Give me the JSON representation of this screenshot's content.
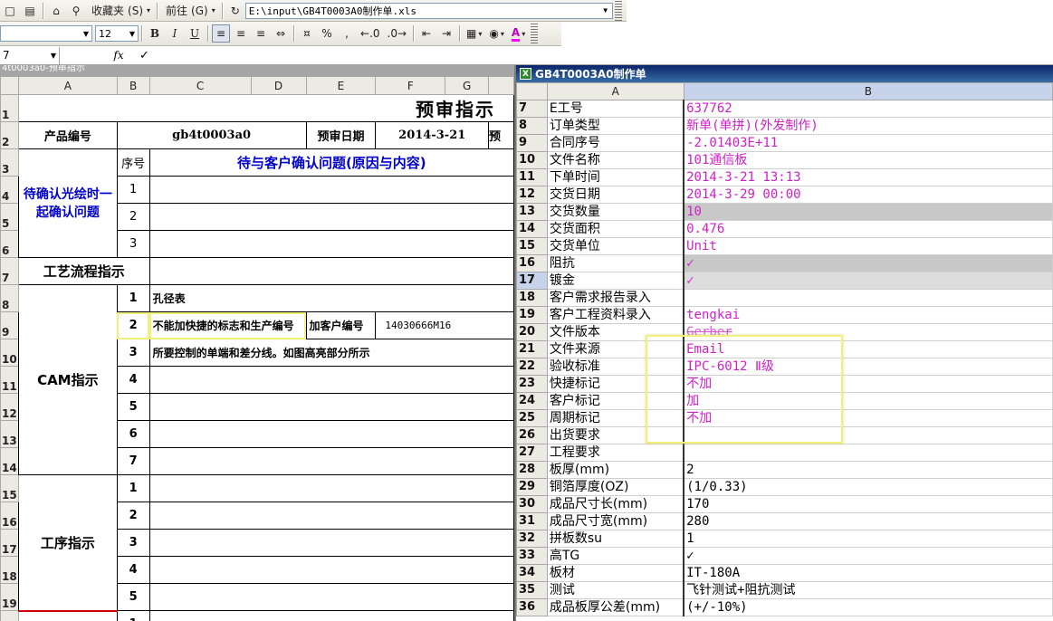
{
  "toolbar1": {
    "favorites_label": "收藏夹",
    "favorites_key": "(S)",
    "forward_label": "前往",
    "forward_key": "(G)",
    "address_value": "E:\\input\\GB4T0003A0制作单.xls"
  },
  "toolbar2": {
    "font_size": "12",
    "bold": "B",
    "italic": "I",
    "underline": "U",
    "percent": "%",
    "comma": ",",
    "font_color": "A"
  },
  "formula_bar": {
    "namebox": "7",
    "fx_label": "fx",
    "content": "✓"
  },
  "left_sheet": {
    "window_title": "4t0003a0-预审指示",
    "columns": [
      "A",
      "B",
      "C",
      "D",
      "E",
      "F",
      "G"
    ],
    "row_numbers": [
      "1",
      "2",
      "3",
      "4",
      "5",
      "6",
      "7",
      "8",
      "9",
      "10",
      "11",
      "12",
      "13",
      "14",
      "15",
      "16",
      "17",
      "18",
      "19"
    ],
    "title": "预审指示",
    "product_label": "产品编号",
    "product_value": "gb4t0003a0",
    "date_label": "预审日期",
    "date_value": "2014-3-21",
    "date_overflow": "预",
    "confirm_label": "待确认光绘时一起确认问题",
    "seq_header": "序号",
    "question_header": "待与客户确认问题(原因与内容)",
    "confirm_nums": [
      "1",
      "2",
      "3"
    ],
    "process_flow_label": "工艺流程指示",
    "cam_label": "CAM指示",
    "cam_rows": [
      {
        "num": "1",
        "text": "孔径表",
        "extra": "",
        "code": ""
      },
      {
        "num": "2",
        "text": "不能加快捷的标志和生产编号",
        "extra": "加客户编号",
        "code": "14030666M16"
      },
      {
        "num": "3",
        "text": "所要控制的单端和差分线。如图高亮部分所示",
        "extra": "",
        "code": ""
      },
      {
        "num": "4",
        "text": "",
        "extra": "",
        "code": ""
      },
      {
        "num": "5",
        "text": "",
        "extra": "",
        "code": ""
      },
      {
        "num": "6",
        "text": "",
        "extra": "",
        "code": ""
      },
      {
        "num": "7",
        "text": "",
        "extra": "",
        "code": ""
      }
    ],
    "process_label": "工序指示",
    "process_nums": [
      "1",
      "2",
      "3",
      "4",
      "5"
    ],
    "last_row_num": "1"
  },
  "right_sheet": {
    "window_title": "GB4T0003A0制作单",
    "columns": [
      "A",
      "B"
    ],
    "rows": [
      {
        "n": "7",
        "label": "E工号",
        "value": "637762",
        "style": "mag"
      },
      {
        "n": "8",
        "label": "订单类型",
        "value": "新单(单拼)(外发制作)",
        "style": "mag"
      },
      {
        "n": "9",
        "label": "合同序号",
        "value": "-2.01403E+11",
        "style": "mag"
      },
      {
        "n": "10",
        "label": "文件名称",
        "value": "101通信板",
        "style": "mag"
      },
      {
        "n": "11",
        "label": "下单时间",
        "value": "2014-3-21 13:13",
        "style": "mag"
      },
      {
        "n": "12",
        "label": "交货日期",
        "value": "2014-3-29 00:00",
        "style": "mag"
      },
      {
        "n": "13",
        "label": "交货数量",
        "value": "10",
        "style": "mag gray"
      },
      {
        "n": "14",
        "label": "交货面积",
        "value": "0.476",
        "style": "mag"
      },
      {
        "n": "15",
        "label": "交货单位",
        "value": "Unit",
        "style": "mag"
      },
      {
        "n": "16",
        "label": "阻抗",
        "value": "✓",
        "style": "mag gray"
      },
      {
        "n": "17",
        "label": "镀金",
        "value": "✓",
        "style": "mag ltgray"
      },
      {
        "n": "18",
        "label": "客户需求报告录入",
        "value": "",
        "style": "mag"
      },
      {
        "n": "19",
        "label": "客户工程资料录入",
        "value": "tengkai",
        "style": "mag"
      },
      {
        "n": "20",
        "label": "文件版本",
        "value": "Gerber",
        "style": "mag strike"
      },
      {
        "n": "21",
        "label": "文件来源",
        "value": "Email",
        "style": "mag"
      },
      {
        "n": "22",
        "label": "验收标准",
        "value": "IPC-6012 Ⅱ级",
        "style": "mag"
      },
      {
        "n": "23",
        "label": "快捷标记",
        "value": "不加",
        "style": "mag"
      },
      {
        "n": "24",
        "label": "客户标记",
        "value": "加",
        "style": "mag"
      },
      {
        "n": "25",
        "label": "周期标记",
        "value": "不加",
        "style": "mag"
      },
      {
        "n": "26",
        "label": "出货要求",
        "value": "",
        "style": "mag"
      },
      {
        "n": "27",
        "label": "工程要求",
        "value": "",
        "style": "mag"
      },
      {
        "n": "28",
        "label": "板厚(mm)",
        "value": "2",
        "style": "blk"
      },
      {
        "n": "29",
        "label": "铜箔厚度(OZ)",
        "value": "(1/0.33)",
        "style": "blk"
      },
      {
        "n": "30",
        "label": "成品尺寸长(mm)",
        "value": "170",
        "style": "blk"
      },
      {
        "n": "31",
        "label": "成品尺寸宽(mm)",
        "value": "280",
        "style": "blk"
      },
      {
        "n": "32",
        "label": "拼板数su",
        "value": "1",
        "style": "blk"
      },
      {
        "n": "33",
        "label": "高TG",
        "value": "✓",
        "style": "blk"
      },
      {
        "n": "34",
        "label": "板材",
        "value": "IT-180A",
        "style": "blk"
      },
      {
        "n": "35",
        "label": "测试",
        "value": "飞针测试+阻抗测试",
        "style": "blk"
      },
      {
        "n": "36",
        "label": "成品板厚公差(mm)",
        "value": "(+/-10%)",
        "style": "blk"
      }
    ]
  }
}
